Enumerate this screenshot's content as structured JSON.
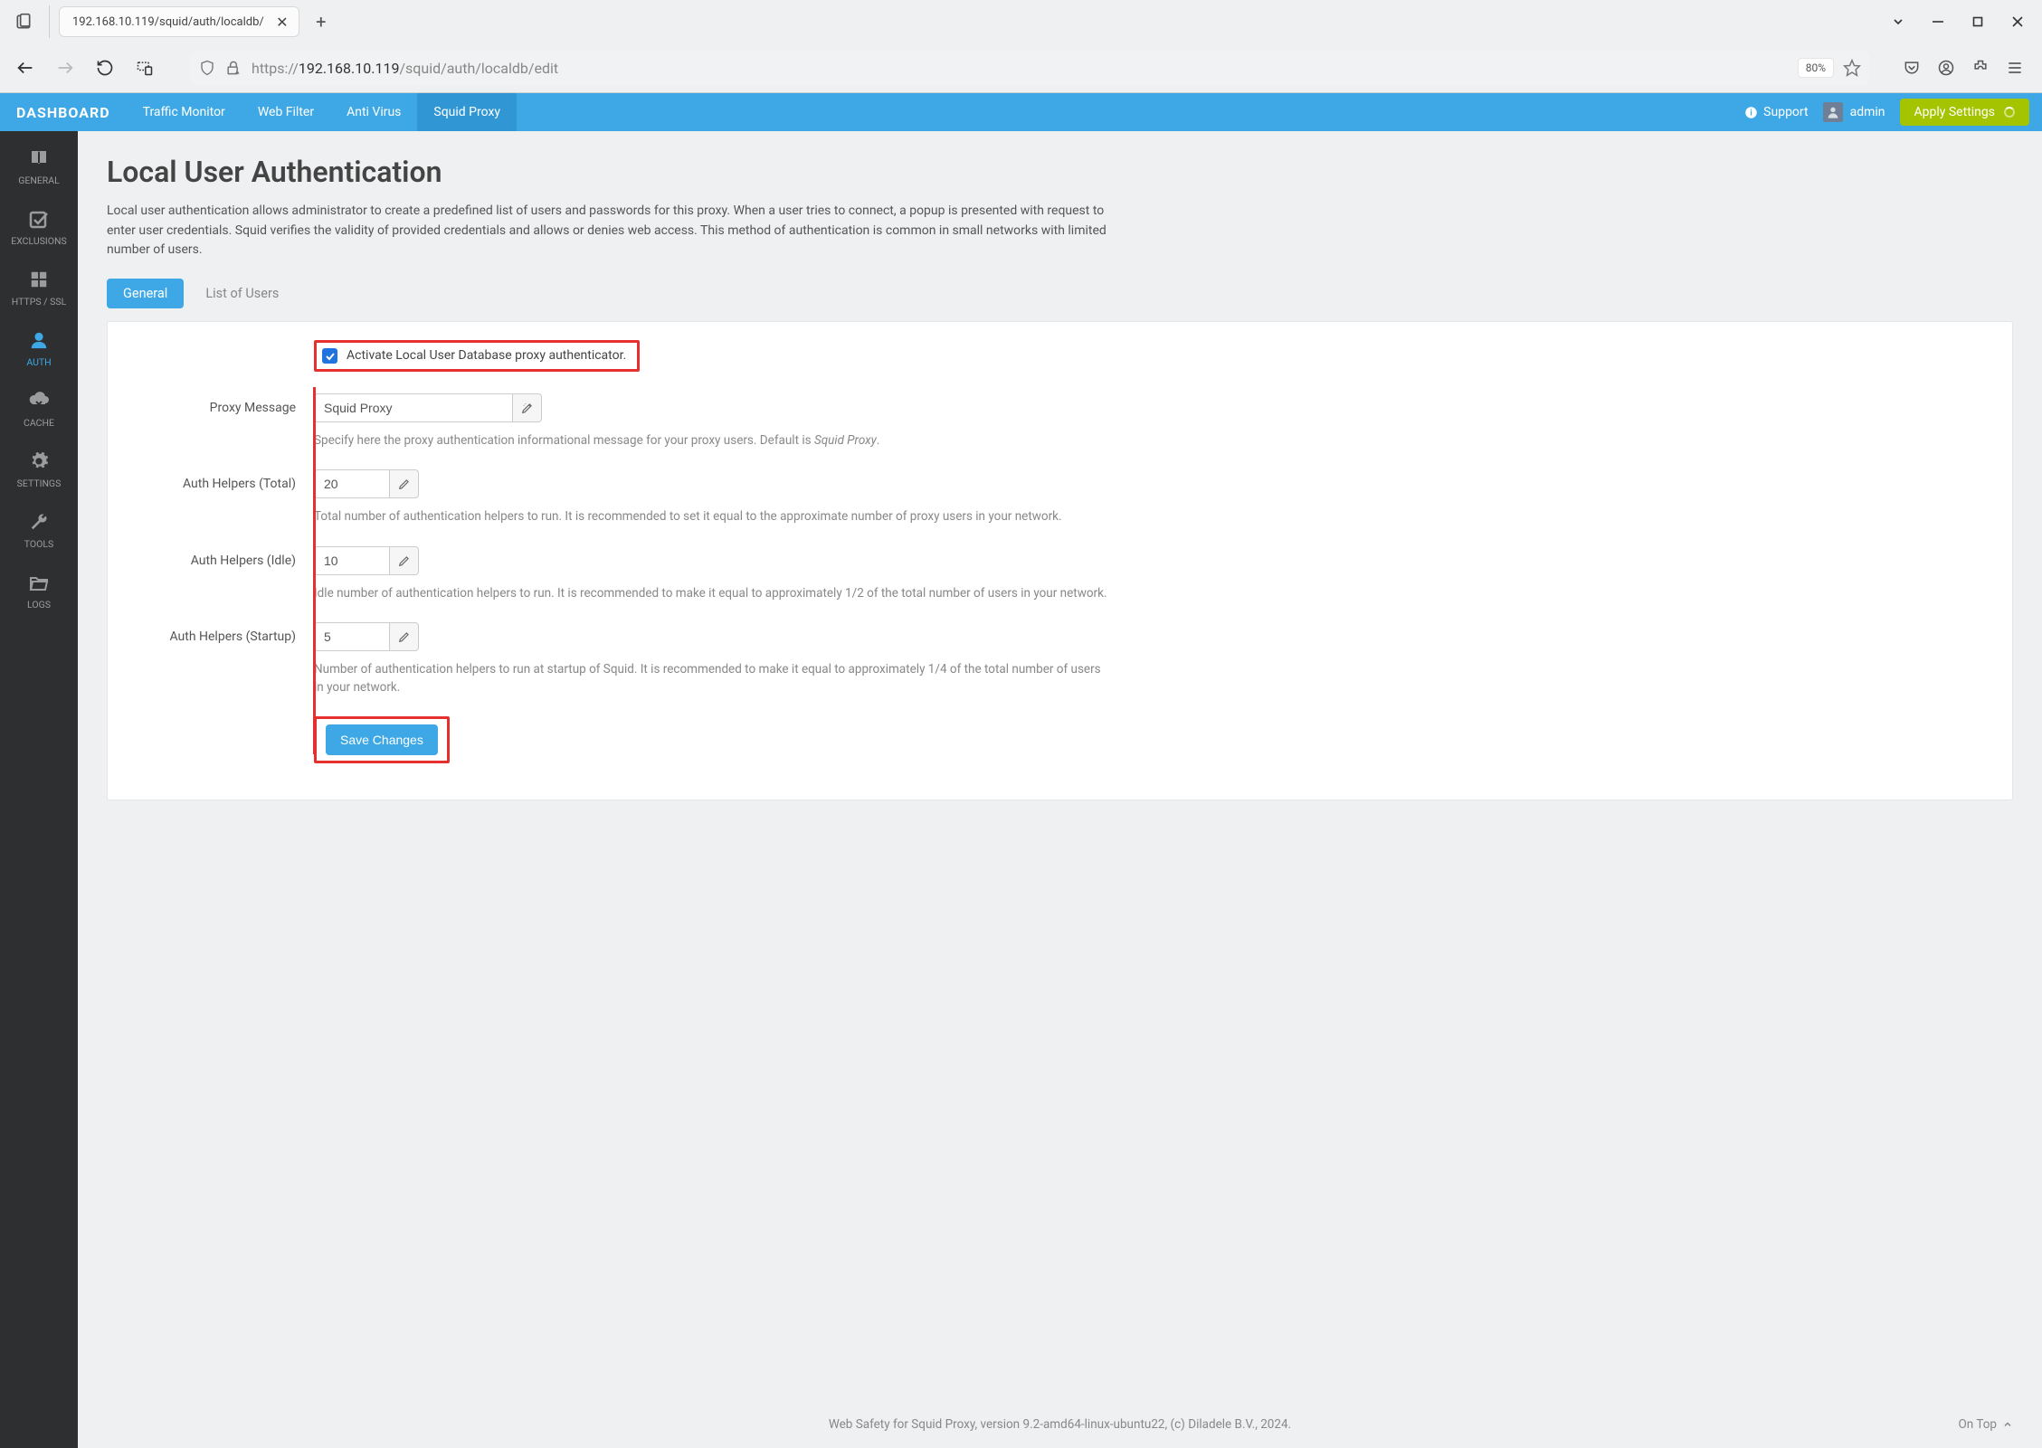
{
  "browser": {
    "tab_title": "192.168.10.119/squid/auth/localdb/",
    "url_prefix": "https://",
    "url_host": "192.168.10.119",
    "url_path": "/squid/auth/localdb/edit",
    "zoom": "80%"
  },
  "topnav": {
    "brand": "DASHBOARD",
    "items": [
      "Traffic Monitor",
      "Web Filter",
      "Anti Virus",
      "Squid Proxy"
    ],
    "active_index": 3,
    "support": "Support",
    "user": "admin",
    "apply": "Apply Settings"
  },
  "sidebar": {
    "items": [
      {
        "label": "GENERAL",
        "icon": "book"
      },
      {
        "label": "EXCLUSIONS",
        "icon": "check-square"
      },
      {
        "label": "HTTPS / SSL",
        "icon": "grid"
      },
      {
        "label": "AUTH",
        "icon": "user"
      },
      {
        "label": "CACHE",
        "icon": "cloud-down"
      },
      {
        "label": "SETTINGS",
        "icon": "gear"
      },
      {
        "label": "TOOLS",
        "icon": "wrench"
      },
      {
        "label": "LOGS",
        "icon": "folder-open"
      }
    ],
    "active_index": 3
  },
  "page": {
    "title": "Local User Authentication",
    "description": "Local user authentication allows administrator to create a predefined list of users and passwords for this proxy. When a user tries to connect, a popup is presented with request to enter user credentials. Squid verifies the validity of provided credentials and allows or denies web access. This method of authentication is common in small networks with limited number of users.",
    "tabs": [
      "General",
      "List of Users"
    ],
    "active_tab": 0
  },
  "form": {
    "activate_label": "Activate Local User Database proxy authenticator.",
    "activate_checked": true,
    "proxy_message": {
      "label": "Proxy Message",
      "value": "Squid Proxy",
      "help_pre": "Specify here the proxy authentication informational message for your proxy users. Default is ",
      "help_italic": "Squid Proxy",
      "help_post": "."
    },
    "helpers_total": {
      "label": "Auth Helpers (Total)",
      "value": "20",
      "help": "Total number of authentication helpers to run. It is recommended to set it equal to the approximate number of proxy users in your network."
    },
    "helpers_idle": {
      "label": "Auth Helpers (Idle)",
      "value": "10",
      "help": "Idle number of authentication helpers to run. It is recommended to make it equal to approximately 1/2 of the total number of users in your network."
    },
    "helpers_startup": {
      "label": "Auth Helpers (Startup)",
      "value": "5",
      "help": "Number of authentication helpers to run at startup of Squid. It is recommended to make it equal to approximately 1/4 of the total number of users in your network."
    },
    "save": "Save Changes"
  },
  "footer": {
    "text": "Web Safety for Squid Proxy, version 9.2-amd64-linux-ubuntu22, (c) Diladele B.V., 2024.",
    "on_top": "On Top"
  }
}
